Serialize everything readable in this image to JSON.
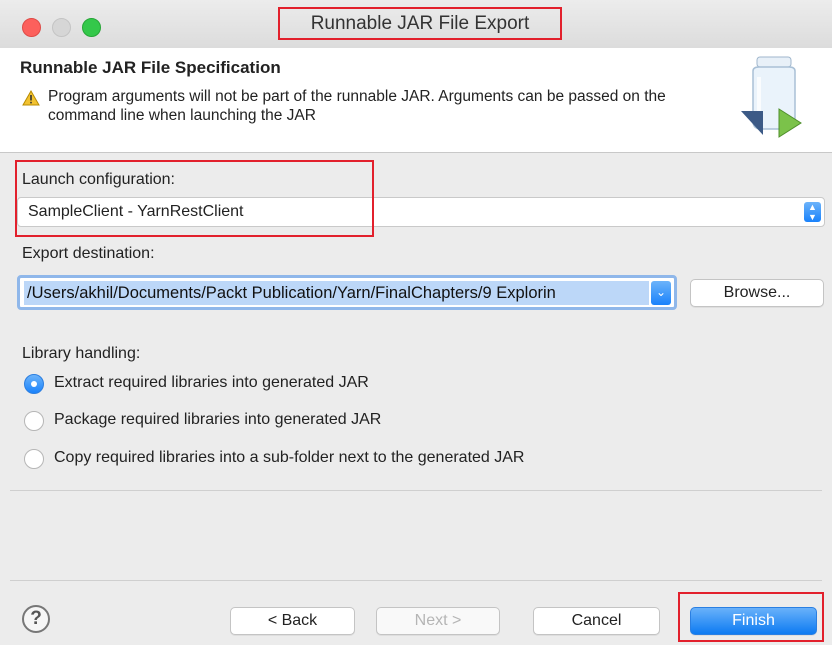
{
  "window": {
    "title": "Runnable JAR File Export"
  },
  "header": {
    "title": "Runnable JAR File Specification",
    "message": "Program arguments will not be part of the runnable JAR. Arguments can be passed on the command line when launching the JAR",
    "warning_icon": "warning-icon",
    "jar_icon": "jar-export-icon"
  },
  "launch": {
    "label": "Launch configuration:",
    "value": "SampleClient - YarnRestClient"
  },
  "export": {
    "label": "Export destination:",
    "value": "/Users/akhil/Documents/Packt Publication/Yarn/FinalChapters/9 Explorin",
    "browse_label": "Browse..."
  },
  "library": {
    "label": "Library handling:",
    "options": [
      {
        "label": "Extract required libraries into generated JAR",
        "checked": true
      },
      {
        "label": "Package required libraries into generated JAR",
        "checked": false
      },
      {
        "label": "Copy required libraries into a sub-folder next to the generated JAR",
        "checked": false
      }
    ]
  },
  "footer": {
    "help": "?",
    "back": "< Back",
    "next": "Next >",
    "cancel": "Cancel",
    "finish": "Finish"
  },
  "colors": {
    "highlight": "#e2202c",
    "accent": "#1a82fb"
  }
}
